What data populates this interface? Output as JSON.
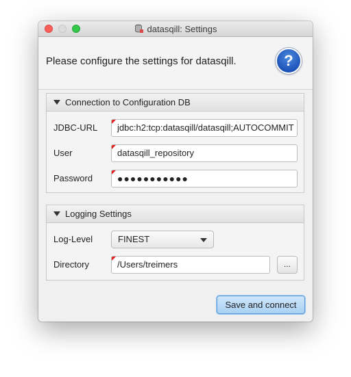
{
  "window": {
    "title": "datasqill: Settings"
  },
  "header": {
    "message": "Please configure the settings for datasqill.",
    "help_symbol": "?"
  },
  "connection": {
    "title": "Connection to Configuration DB",
    "jdbc_label": "JDBC-URL",
    "jdbc_value": "jdbc:h2:tcp:datasqill/datasqill;AUTOCOMMIT",
    "user_label": "User",
    "user_value": "datasqill_repository",
    "password_label": "Password",
    "password_value": "●●●●●●●●●●●"
  },
  "logging": {
    "title": "Logging Settings",
    "level_label": "Log-Level",
    "level_value": "FINEST",
    "directory_label": "Directory",
    "directory_value": "/Users/treimers",
    "browse_label": "..."
  },
  "actions": {
    "save_label": "Save and connect"
  },
  "colors": {
    "accent": "#a9d1f4",
    "required_flag": "#e02020",
    "help": "#1d53b8"
  }
}
